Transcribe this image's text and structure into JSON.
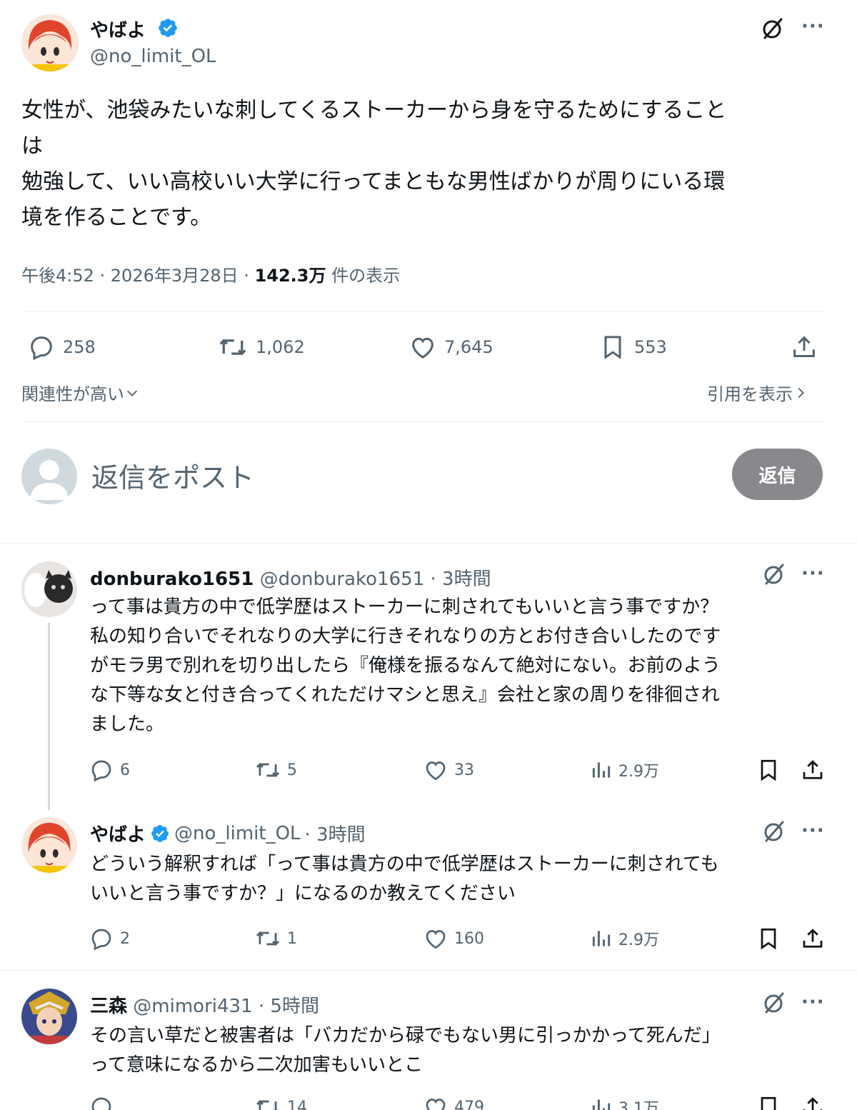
{
  "main": {
    "author_name": "やばよ",
    "author_handle": "@no_limit_OL",
    "text_lines": [
      "女性が、池袋みたいな刺してくるストーカーから身を守るためにすること",
      "は",
      "勉強して、いい高校いい大学に行ってまともな男性ばかりが周りにいる環",
      "境を作ることです。"
    ],
    "time": "午後4:52 · 2026年3月28日 · ",
    "views": "142.3万",
    "views_label": " 件の表示",
    "replies": "258",
    "reposts": "1,062",
    "likes": "7,645",
    "bookmarks": "553",
    "sort_label": "関連性が高い",
    "quotes_label": "引用を表示",
    "reply_placeholder": "返信をポスト",
    "reply_button": "返信"
  },
  "replies": [
    {
      "name": "donburako1651",
      "handle": "@donburako1651",
      "time": " · 3時間",
      "lines": [
        "って事は貴方の中で低学歴はストーカーに刺されてもいいと言う事ですか？",
        "私の知り合いでそれなりの大学に行きそれなりの方とお付き合いしたのです",
        "がモラ男で別れを切り出したら『俺様を振るなんて絶対にない。お前のよう",
        "な下等な女と付き合ってくれただけマシと思え』会社と家の周りを徘徊され",
        "ました。"
      ],
      "replies": "6",
      "reposts": "5",
      "likes": "33",
      "views": "2.9万"
    },
    {
      "name": "やばよ",
      "handle": "@no_limit_OL",
      "time": " · 3時間",
      "lines": [
        "どういう解釈すれば「って事は貴方の中で低学歴はストーカーに刺されても",
        "いいと言う事ですか？」になるのか教えてください"
      ],
      "replies": "2",
      "reposts": "1",
      "likes": "160",
      "views": "2.9万"
    },
    {
      "name": "三森",
      "handle": "@mimori431",
      "time": " · 5時間",
      "lines": [
        "その言い草だと被害者は「バカだから碌でもない男に引っかかって死んだ」",
        "って意味になるから二次加害もいいとこ"
      ],
      "replies": "",
      "reposts": "14",
      "likes": "479",
      "views": "3.1万"
    }
  ],
  "colors": {
    "verified": "#1d9bf0",
    "muted": "#536471",
    "divider": "#eff3f4",
    "reply_button": "#87898c"
  },
  "icons": [
    "grok-icon",
    "more-icon",
    "reply-icon",
    "repost-icon",
    "like-icon",
    "bookmark-icon",
    "share-icon",
    "views-icon",
    "verified-icon",
    "chevron-down-icon",
    "chevron-right-icon"
  ]
}
